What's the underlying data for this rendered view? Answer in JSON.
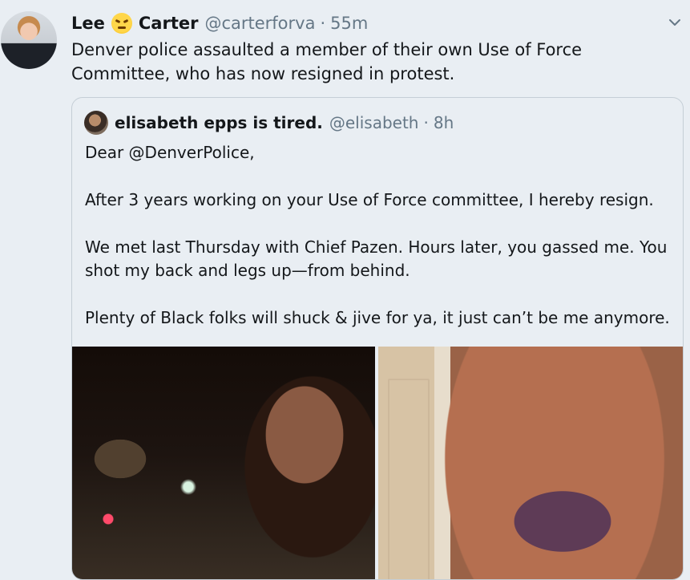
{
  "tweet": {
    "author_name_first": "Lee",
    "author_name_last": "Carter",
    "author_emoji": "angry-face",
    "handle": "@carterforva",
    "separator": "·",
    "time": "55m",
    "text": "Denver police assaulted a member of their own Use of Force Committee, who has now resigned in protest."
  },
  "quote": {
    "author_name": "elisabeth epps is tired.",
    "handle": "@elisabeth",
    "separator": "·",
    "time": "8h",
    "paragraphs": [
      "Dear @DenverPolice,",
      "After 3 years working on your Use of Force committee, I hereby resign.",
      "We met last Thursday with Chief Pazen. Hours later, you gassed me. You shot my back and legs up—from behind.",
      "Plenty of Black folks will shuck & jive for ya, it just can’t be me anymore."
    ]
  },
  "icons": {
    "more": "chevron-down-icon"
  },
  "colors": {
    "background": "#e9eef3",
    "muted": "#657786",
    "text": "#14171a"
  }
}
